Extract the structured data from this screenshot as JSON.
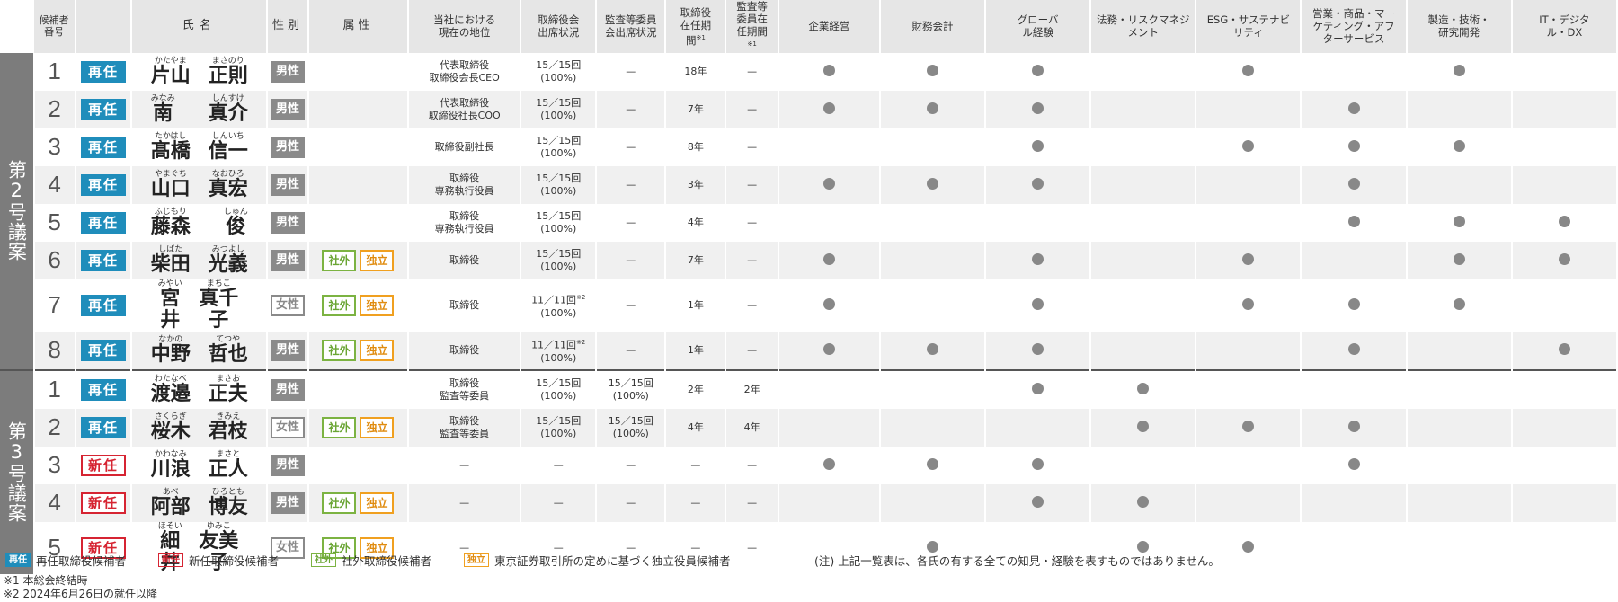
{
  "headers": {
    "num": "候補者番号",
    "name": "氏名",
    "sex": "性別",
    "attr": "属性",
    "position": "当社における現在の地位",
    "attendance": "取締役会出席状況",
    "audit_attendance": "監査等委員会出席状況",
    "tenure": "取締役在任期間",
    "tenure_mark": "※1",
    "audit_tenure": "監査等委員在任期間",
    "audit_tenure_mark": "※1",
    "skills": [
      "企業経営",
      "財務会計",
      "グローバル経験",
      "法務・リスクマネジメント",
      "ESG・サステナビリティ",
      "営業・商品・マーケティング・アフターサービス",
      "製造・技術・研究開発",
      "IT・デジタル・DX"
    ]
  },
  "groups": [
    {
      "label": "第2号議案",
      "rows": 8
    },
    {
      "label": "第3号議案",
      "rows": 5
    }
  ],
  "badges": {
    "re": "再任",
    "new": "新任",
    "male": "男性",
    "female": "女性",
    "outside": "社外",
    "independent": "独立"
  },
  "candidates": [
    {
      "num": "1",
      "status": "re",
      "surname": "片山",
      "surname_ruby": "かたやま",
      "given": "正則",
      "given_ruby": "まさのり",
      "sex": "male",
      "outside": false,
      "independent": false,
      "position": "代表取締役\n取締役会長CEO",
      "attendance": "15／15回\n(100%)",
      "attendance_mark": "",
      "audit_attendance": "—",
      "tenure": "18年",
      "audit_tenure": "—",
      "skills": [
        true,
        true,
        true,
        false,
        true,
        false,
        true,
        false
      ]
    },
    {
      "num": "2",
      "status": "re",
      "surname": "南",
      "surname_ruby": "みなみ",
      "given": "真介",
      "given_ruby": "しんすけ",
      "sex": "male",
      "outside": false,
      "independent": false,
      "position": "代表取締役\n取締役社長COO",
      "attendance": "15／15回\n(100%)",
      "attendance_mark": "",
      "audit_attendance": "—",
      "tenure": "7年",
      "audit_tenure": "—",
      "skills": [
        true,
        true,
        true,
        false,
        false,
        true,
        false,
        false
      ]
    },
    {
      "num": "3",
      "status": "re",
      "surname": "髙橋",
      "surname_ruby": "たかはし",
      "given": "信一",
      "given_ruby": "しんいち",
      "sex": "male",
      "outside": false,
      "independent": false,
      "position": "取締役副社長",
      "attendance": "15／15回\n(100%)",
      "attendance_mark": "",
      "audit_attendance": "—",
      "tenure": "8年",
      "audit_tenure": "—",
      "skills": [
        false,
        false,
        true,
        false,
        true,
        true,
        true,
        false
      ]
    },
    {
      "num": "4",
      "status": "re",
      "surname": "山口",
      "surname_ruby": "やまぐち",
      "given": "真宏",
      "given_ruby": "なおひろ",
      "sex": "male",
      "outside": false,
      "independent": false,
      "position": "取締役\n専務執行役員",
      "attendance": "15／15回\n(100%)",
      "attendance_mark": "",
      "audit_attendance": "—",
      "tenure": "3年",
      "audit_tenure": "—",
      "skills": [
        true,
        true,
        true,
        false,
        false,
        true,
        false,
        false
      ]
    },
    {
      "num": "5",
      "status": "re",
      "surname": "藤森",
      "surname_ruby": "ふじもり",
      "given": "俊",
      "given_ruby": "しゅん",
      "sex": "male",
      "outside": false,
      "independent": false,
      "position": "取締役\n専務執行役員",
      "attendance": "15／15回\n(100%)",
      "attendance_mark": "",
      "audit_attendance": "—",
      "tenure": "4年",
      "audit_tenure": "—",
      "skills": [
        false,
        false,
        false,
        false,
        false,
        true,
        true,
        true
      ]
    },
    {
      "num": "6",
      "status": "re",
      "surname": "柴田",
      "surname_ruby": "しばた",
      "given": "光義",
      "given_ruby": "みつよし",
      "sex": "male",
      "outside": true,
      "independent": true,
      "position": "取締役",
      "attendance": "15／15回\n(100%)",
      "attendance_mark": "",
      "audit_attendance": "—",
      "tenure": "7年",
      "audit_tenure": "—",
      "skills": [
        true,
        false,
        true,
        false,
        true,
        false,
        true,
        true
      ]
    },
    {
      "num": "7",
      "status": "re",
      "surname": "宮井",
      "surname_ruby": "みやい",
      "given": "真千子",
      "given_ruby": "まちこ",
      "sex": "female",
      "outside": true,
      "independent": true,
      "position": "取締役",
      "attendance": "11／11回",
      "attendance_mark": "※2",
      "attendance2": "(100%)",
      "audit_attendance": "—",
      "tenure": "1年",
      "audit_tenure": "—",
      "skills": [
        true,
        false,
        true,
        false,
        true,
        true,
        true,
        false
      ]
    },
    {
      "num": "8",
      "status": "re",
      "surname": "中野",
      "surname_ruby": "なかの",
      "given": "哲也",
      "given_ruby": "てつや",
      "sex": "male",
      "outside": true,
      "independent": true,
      "position": "取締役",
      "attendance": "11／11回",
      "attendance_mark": "※2",
      "attendance2": "(100%)",
      "audit_attendance": "—",
      "tenure": "1年",
      "audit_tenure": "—",
      "skills": [
        true,
        true,
        true,
        false,
        false,
        true,
        false,
        true
      ]
    },
    {
      "num": "1",
      "status": "re",
      "surname": "渡邉",
      "surname_ruby": "わたなべ",
      "given": "正夫",
      "given_ruby": "まさお",
      "sex": "male",
      "outside": false,
      "independent": false,
      "position": "取締役\n監査等委員",
      "attendance": "15／15回\n(100%)",
      "attendance_mark": "",
      "audit_attendance": "15／15回\n(100%)",
      "tenure": "2年",
      "audit_tenure": "2年",
      "skills": [
        false,
        false,
        true,
        true,
        false,
        false,
        false,
        false
      ]
    },
    {
      "num": "2",
      "status": "re",
      "surname": "桜木",
      "surname_ruby": "さくらぎ",
      "given": "君枝",
      "given_ruby": "きみえ",
      "sex": "female",
      "outside": true,
      "independent": true,
      "position": "取締役\n監査等委員",
      "attendance": "15／15回\n(100%)",
      "attendance_mark": "",
      "audit_attendance": "15／15回\n(100%)",
      "tenure": "4年",
      "audit_tenure": "4年",
      "skills": [
        false,
        false,
        false,
        true,
        true,
        true,
        false,
        false
      ]
    },
    {
      "num": "3",
      "status": "new",
      "surname": "川浪",
      "surname_ruby": "かわなみ",
      "given": "正人",
      "given_ruby": "まさと",
      "sex": "male",
      "outside": false,
      "independent": false,
      "position": "—",
      "attendance": "—",
      "attendance_mark": "",
      "audit_attendance": "—",
      "tenure": "—",
      "audit_tenure": "—",
      "skills": [
        true,
        true,
        true,
        false,
        false,
        true,
        false,
        false
      ]
    },
    {
      "num": "4",
      "status": "new",
      "surname": "阿部",
      "surname_ruby": "あべ",
      "given": "博友",
      "given_ruby": "ひろとも",
      "sex": "male",
      "outside": true,
      "independent": true,
      "position": "—",
      "attendance": "—",
      "attendance_mark": "",
      "audit_attendance": "—",
      "tenure": "—",
      "audit_tenure": "—",
      "skills": [
        false,
        false,
        true,
        true,
        false,
        false,
        false,
        false
      ]
    },
    {
      "num": "5",
      "status": "new",
      "surname": "細井",
      "surname_ruby": "ほそい",
      "given": "友美子",
      "given_ruby": "ゆみこ",
      "sex": "female",
      "outside": true,
      "independent": true,
      "position": "—",
      "attendance": "—",
      "attendance_mark": "",
      "audit_attendance": "—",
      "tenure": "—",
      "audit_tenure": "—",
      "skills": [
        false,
        true,
        false,
        true,
        true,
        false,
        false,
        false
      ]
    }
  ],
  "legend": {
    "re_label": "再任取締役候補者",
    "new_label": "新任取締役候補者",
    "outside_label": "社外取締役候補者",
    "independent_label": "東京証券取引所の定めに基づく独立役員候補者",
    "note": "(注) 上記一覧表は、各氏の有する全ての知見・経験を表すものではありません。"
  },
  "footnotes": [
    "※1 本総会終結時",
    "※2 2024年6月26日の就任以降"
  ],
  "colors": {
    "re": "#1f8dbb",
    "new": "#d62432",
    "outside": "#7cb342",
    "independent": "#f0a020",
    "group": "#7c7c7c",
    "dot": "#888888"
  }
}
